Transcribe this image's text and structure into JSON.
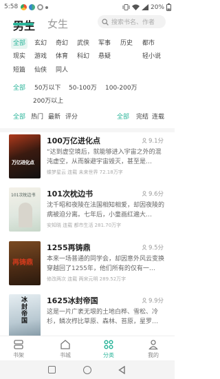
{
  "status_bar": {
    "time": "5:58",
    "battery": "20%"
  },
  "header": {
    "tabs": [
      {
        "label": "男生"
      },
      {
        "label": "女生"
      }
    ],
    "search_placeholder": "搜索书名、作者"
  },
  "filters": {
    "genres": [
      "全部",
      "玄幻",
      "奇幻",
      "武侠",
      "军事",
      "历史",
      "都市",
      "现实",
      "游戏",
      "体育",
      "科幻",
      "悬疑",
      "轻小说",
      "短篇",
      "仙侠",
      "同人"
    ],
    "word_counts": [
      "全部",
      "50万以下",
      "50-100万",
      "100-200万",
      "200万以上"
    ],
    "sort": [
      "全部",
      "热门",
      "最新",
      "评分"
    ],
    "status": [
      "全部",
      "完结",
      "连载"
    ]
  },
  "colors": {
    "accent": "#2bb59a"
  },
  "books": [
    {
      "title": "100万亿进化点",
      "score": "9.1分",
      "desc": "“达到虚空境后，就能够进入宇宙之外的混沌虚空，从而躲避宇宙毁灭，甚至是…",
      "meta": "蝶梦星云 连载 未来世界 72.18万字",
      "cover_text": "万亿进化点"
    },
    {
      "title": "101次枕边书",
      "score": "9.6分",
      "desc": "沈千昭和夜陵在法国相知相爱，却因夜陵的病被迫分离。七年后，小童画红遍大…",
      "meta": "安知晓 连载 都市生活 281.70万字",
      "cover_text": "101次枕边书"
    },
    {
      "title": "1255再铸鼎",
      "score": "9.5分",
      "desc": "本来一场普通的同学会，却因意外风云变换穿越回了1255年，他们所有的仅有一…",
      "meta": "修改两次 连载 两宋元明 289.52万字",
      "cover_text": "再铸鼎"
    },
    {
      "title": "1625冰封帝国",
      "score": "9.9分",
      "desc": "这是一片广袤无垠的土地白桦、雪松、冷杉，鳞次栉比草原、森林、苔原，星罗…",
      "meta": "",
      "cover_text": "冰封帝国"
    }
  ],
  "bottom_nav": [
    {
      "label": "书架",
      "icon": "bookshelf-icon"
    },
    {
      "label": "书城",
      "icon": "bookstore-icon"
    },
    {
      "label": "分类",
      "icon": "category-icon"
    },
    {
      "label": "我的",
      "icon": "profile-icon"
    }
  ]
}
